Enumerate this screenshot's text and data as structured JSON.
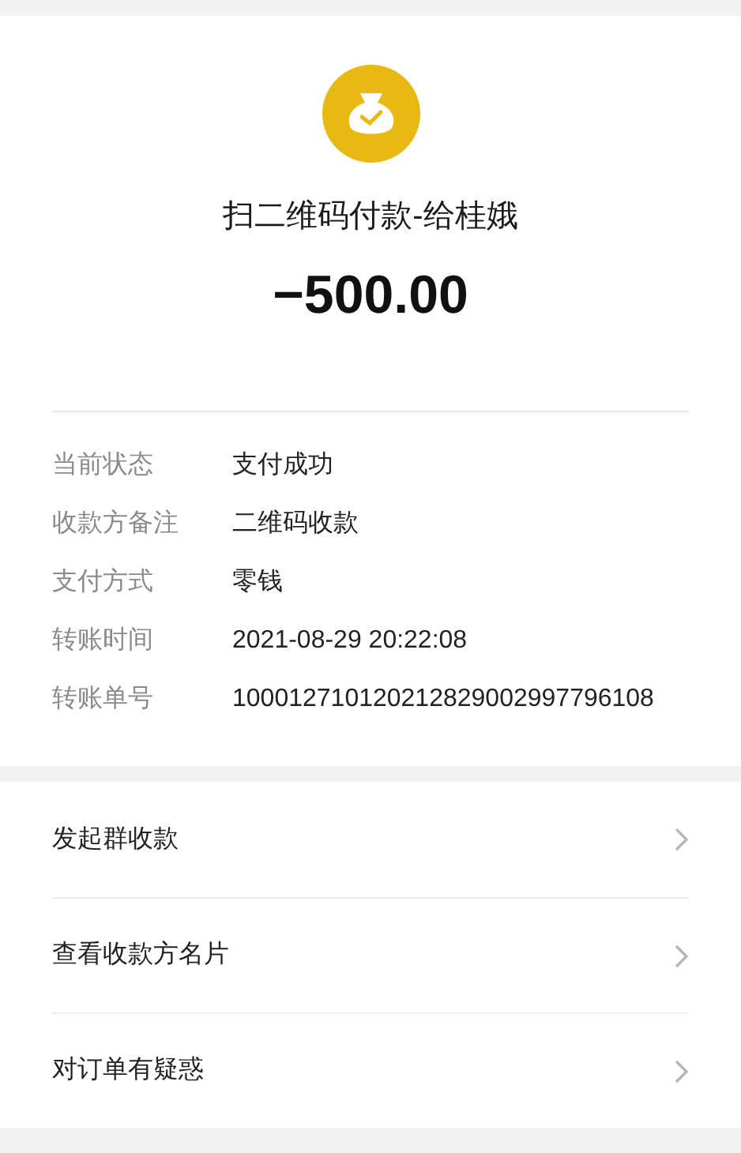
{
  "header": {
    "title": "扫二维码付款-给桂娥",
    "amount": "−500.00"
  },
  "details": [
    {
      "label": "当前状态",
      "value": "支付成功"
    },
    {
      "label": "收款方备注",
      "value": "二维码收款"
    },
    {
      "label": "支付方式",
      "value": "零钱"
    },
    {
      "label": "转账时间",
      "value": "2021-08-29 20:22:08"
    },
    {
      "label": "转账单号",
      "value": "100012710120212829002997796108"
    }
  ],
  "actions": [
    {
      "label": "发起群收款"
    },
    {
      "label": "查看收款方名片"
    },
    {
      "label": "对订单有疑惑"
    }
  ]
}
